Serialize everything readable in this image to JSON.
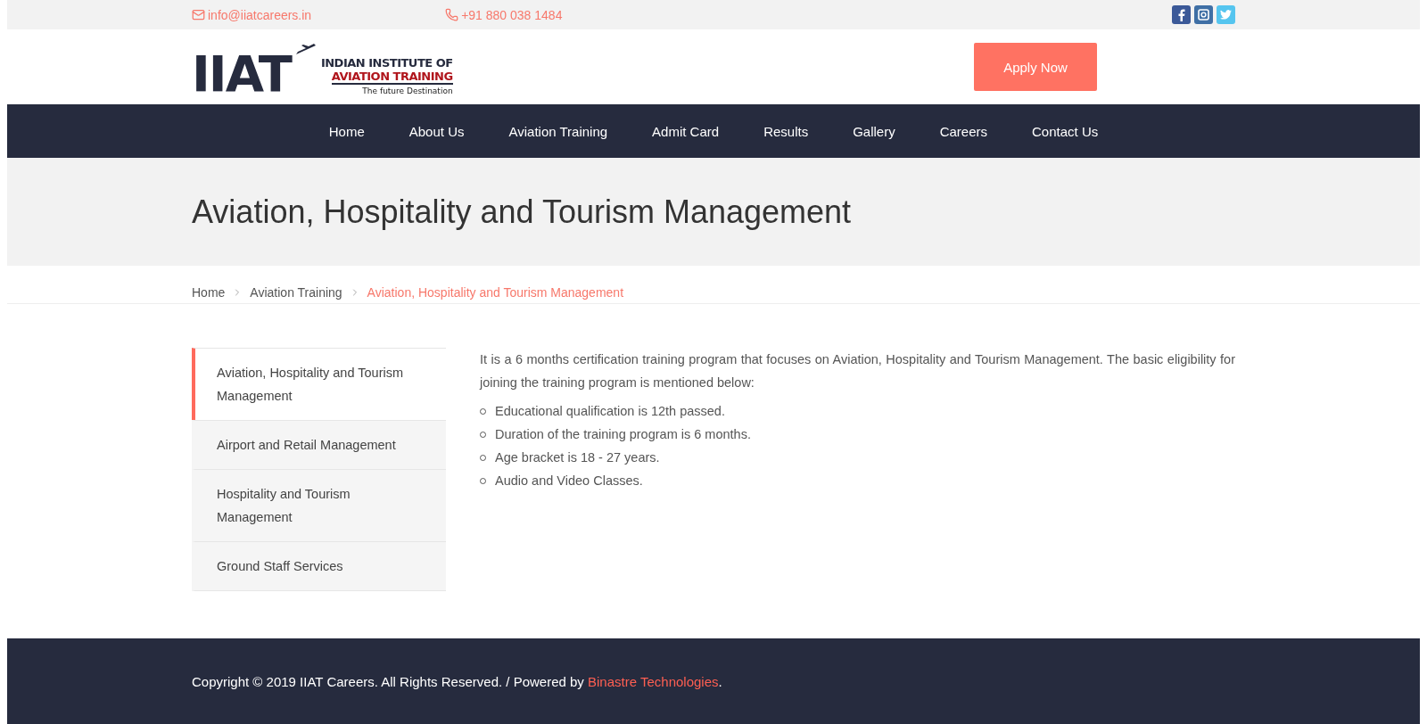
{
  "topbar": {
    "email": "info@iiatcareers.in",
    "phone": "+91 880 038 1484",
    "social": [
      {
        "kind": "facebook",
        "color": "#3b5998"
      },
      {
        "kind": "instagram",
        "color": "#3f6fa5"
      },
      {
        "kind": "twitter",
        "color": "#55c5ef"
      }
    ]
  },
  "header": {
    "logo": {
      "mark": "IIAT",
      "line1": "INDIAN INSTITUTE OF",
      "line2": "AVIATION TRAINING",
      "tagline": "The future Destination"
    },
    "cta": "Apply Now"
  },
  "nav": [
    "Home",
    "About Us",
    "Aviation Training",
    "Admit Card",
    "Results",
    "Gallery",
    "Careers",
    "Contact Us"
  ],
  "page_title": "Aviation, Hospitality and Tourism Management",
  "breadcrumb": [
    {
      "label": "Home",
      "selected": false
    },
    {
      "label": "Aviation Training",
      "selected": false
    },
    {
      "label": "Aviation, Hospitality and Tourism Management",
      "selected": true
    }
  ],
  "sidebar": [
    {
      "label": "Aviation, Hospitality and Tourism Management",
      "selected": true
    },
    {
      "label": "Airport and Retail Management",
      "selected": false
    },
    {
      "label": "Hospitality and Tourism Management",
      "selected": false
    },
    {
      "label": "Ground Staff Services",
      "selected": false
    }
  ],
  "content": {
    "intro": "It is a 6 months certification training program that focuses on Aviation, Hospitality and Tourism Management. The basic eligibility for joining the training program is mentioned below:",
    "bullets": [
      "Educational qualification is 12th passed.",
      "Duration of the training program is 6 months.",
      "Age bracket is 18 - 27 years.",
      "Audio and Video Classes."
    ]
  },
  "footer": {
    "text": "Copyright © 2019 IIAT Careers. All Rights Reserved. / Powered by ",
    "link": "Binastre Technologies",
    "end": "."
  }
}
